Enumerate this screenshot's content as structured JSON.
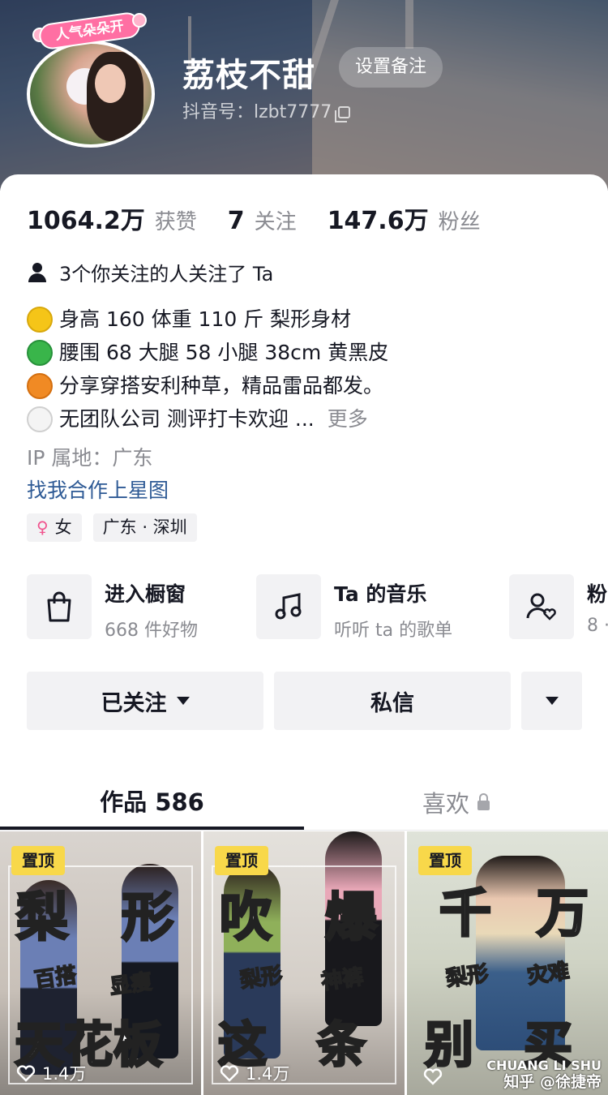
{
  "profile": {
    "name": "荔枝不甜",
    "remark_button": "设置备注",
    "douyin_id": "抖音号：lzbt7777",
    "avatar_badge": "人气朵朵开"
  },
  "stats": [
    {
      "num": "1064.2万",
      "label": "获赞"
    },
    {
      "num": "7",
      "label": "关注"
    },
    {
      "num": "147.6万",
      "label": "粉丝"
    }
  ],
  "follow_note": "3个你关注的人关注了 Ta",
  "bio": [
    {
      "emoji": "yellow-circle",
      "color": "#f5c518",
      "text": "身高 160 体重 110 斤 梨形身材"
    },
    {
      "emoji": "green-circle",
      "color": "#39b54a",
      "text": "腰围 68 大腿 58 小腿 38cm 黄黑皮"
    },
    {
      "emoji": "orange-circle",
      "color": "#f08a24",
      "text": " 分享穿搭安利种草，精品雷品都发。"
    },
    {
      "emoji": "white-circle",
      "color": "#eeeeee",
      "text": " 无团队公司 测评打卡欢迎 ..."
    }
  ],
  "bio_more": "更多",
  "ip": "IP 属地：广东",
  "cooperate_link": "找我合作上星图",
  "tags": [
    {
      "icon": "female-icon",
      "label": "女"
    },
    {
      "icon": "",
      "label": "广东 · 深圳"
    }
  ],
  "entries": [
    {
      "icon": "shopping-bag-icon",
      "title": "进入橱窗",
      "sub": "668 件好物"
    },
    {
      "icon": "music-note-icon",
      "title": "Ta 的音乐",
      "sub": "听听 ta 的歌单"
    },
    {
      "icon": "fan-group-icon",
      "title": "粉",
      "sub": "8 ·"
    }
  ],
  "actions": {
    "followed": "已关注",
    "message": "私信",
    "more_icon": "chevron-down-icon"
  },
  "tabs": {
    "works": "作品 586",
    "likes": "喜欢"
  },
  "videos": [
    {
      "pin": "置顶",
      "big_top": [
        "梨",
        "形"
      ],
      "small": [
        "百搭",
        "显瘦"
      ],
      "big_bottom": "天花板",
      "likes": "1.4万"
    },
    {
      "pin": "置顶",
      "big_top": [
        "吹",
        "爆"
      ],
      "small": [
        "梨形",
        "神裤"
      ],
      "big_bottom": "这　条",
      "likes": "1.4万"
    },
    {
      "pin": "置顶",
      "big_top": [
        "千",
        "万"
      ],
      "small": [
        "梨形",
        "灾难"
      ],
      "big_bottom": "别　买",
      "likes": ""
    }
  ],
  "watermark": {
    "line1": "CHUANG LI SHU",
    "line2": "知乎 @徐捷帝"
  }
}
